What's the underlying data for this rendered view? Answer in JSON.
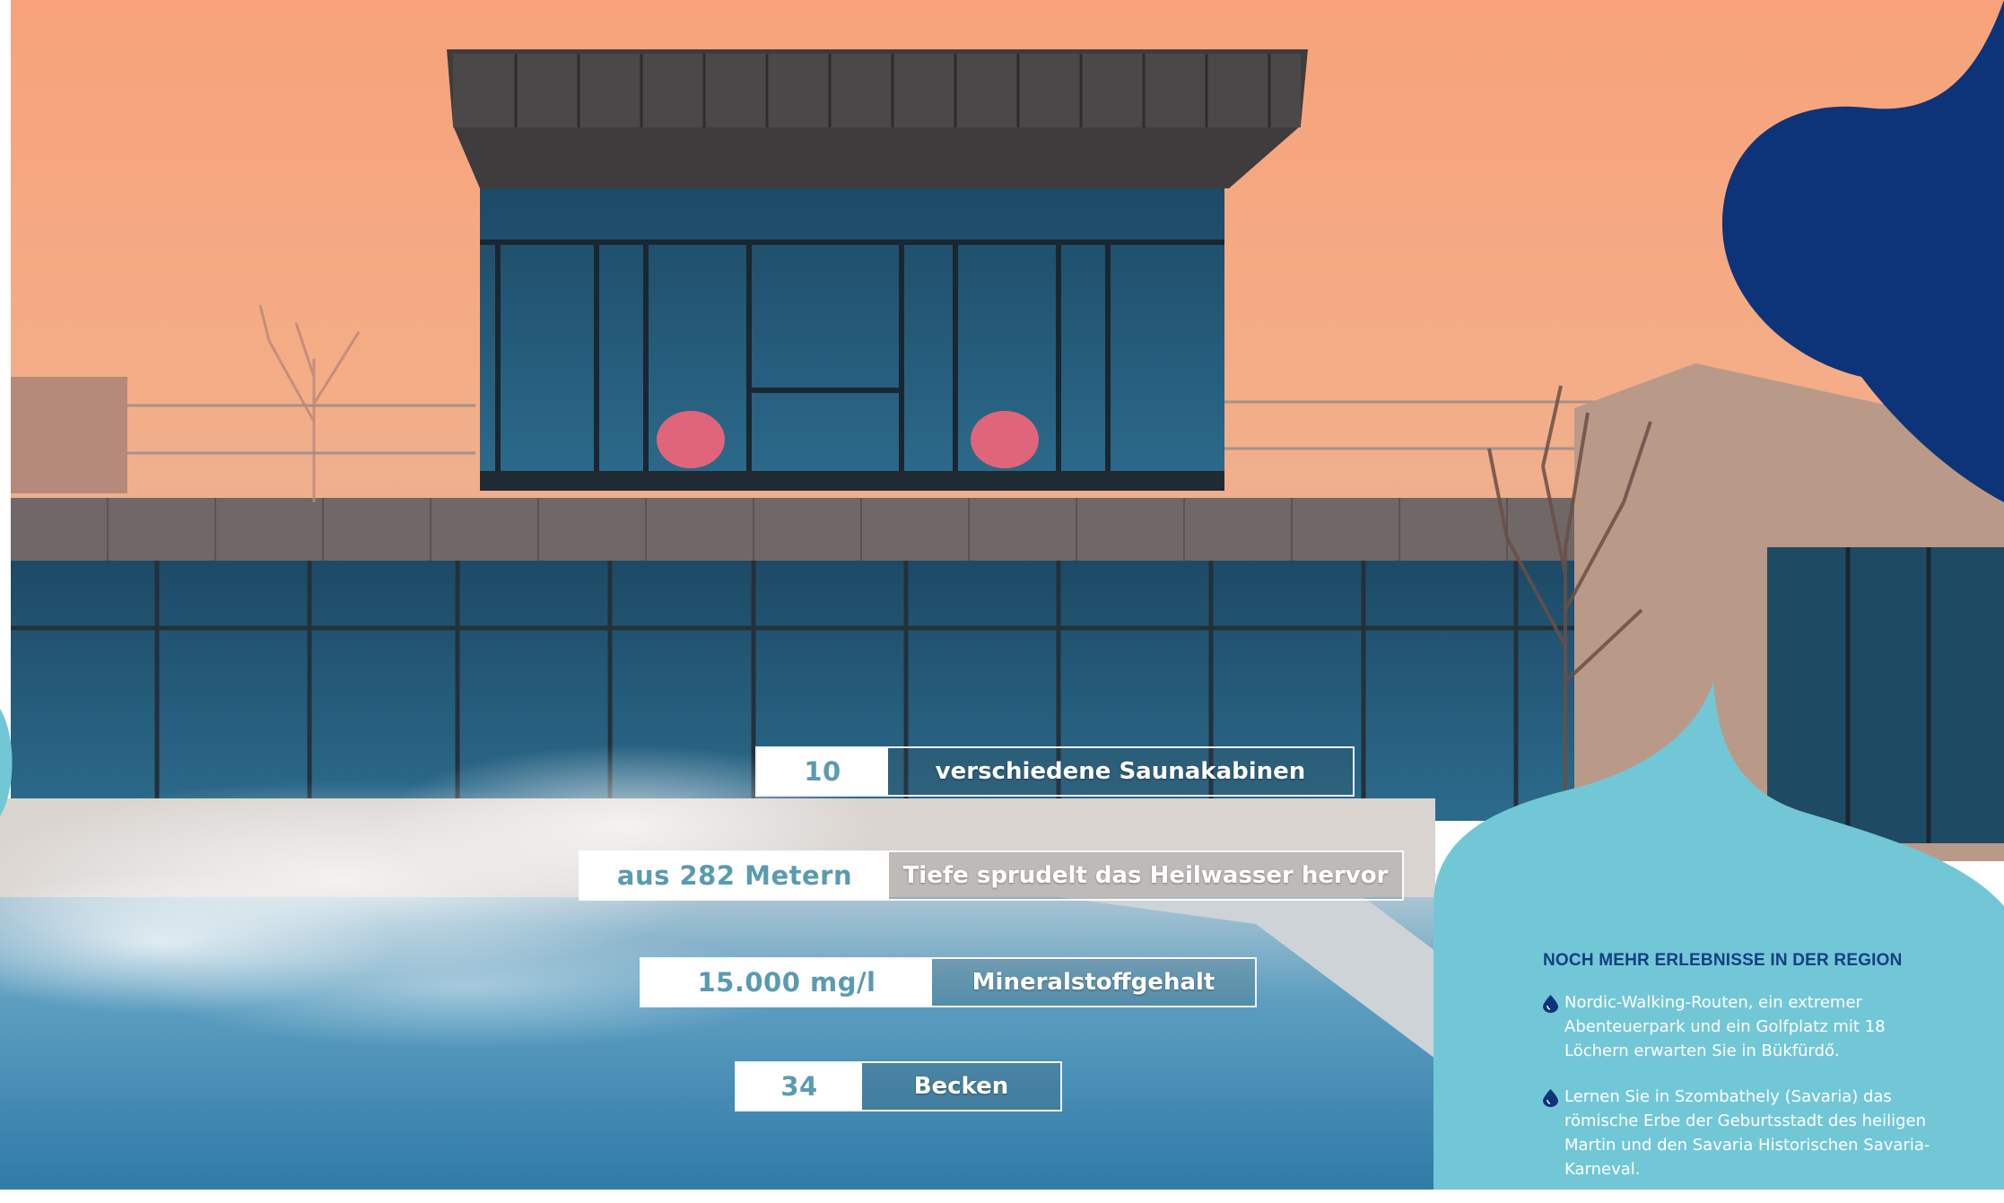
{
  "stats": [
    {
      "value": "10",
      "label": "verschiedene Saunakabinen"
    },
    {
      "value": "aus 282 Metern",
      "label": "Tiefe sprudelt das Heilwasser hervor"
    },
    {
      "value": "15.000 mg/l",
      "label": "Mineralstoffgehalt"
    },
    {
      "value": "34",
      "label": "Becken"
    }
  ],
  "info": {
    "heading": "NOCH MEHR ERLEBNISSE IN DER REGION",
    "items": [
      "Nordic-Walking-Routen, ein extremer Abenteuerpark und ein Golfplatz mit 18 Löchern erwarten Sie in Bükfürdő.",
      "Lernen Sie in Szombathely (Savaria) das römische Erbe der Geburtsstadt des heiligen Martin und den Savaria Historischen Savaria-Karneval."
    ]
  },
  "colors": {
    "sky": "#f3a67c",
    "navy_blob": "#0d3478",
    "teal_blob": "#72c7d6",
    "stat_number": "#5a9bb1",
    "pool": "#4f94b8"
  },
  "icons": [
    "water-drop-icon"
  ]
}
